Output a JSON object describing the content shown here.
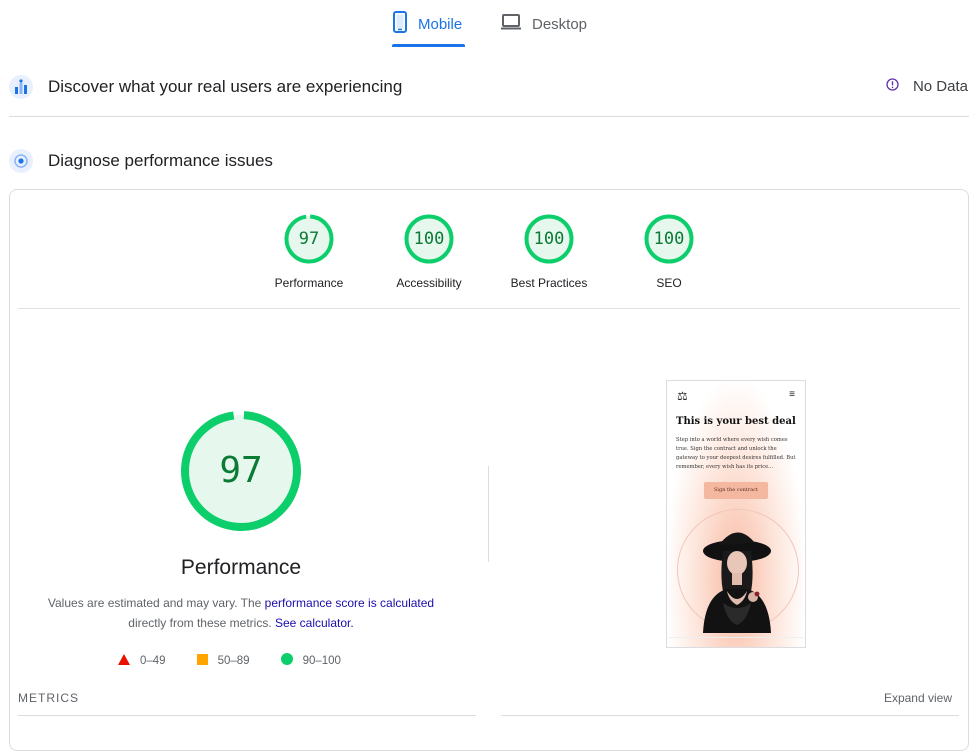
{
  "tabs": [
    {
      "label": "Mobile",
      "icon": "smartphone-icon",
      "active": true
    },
    {
      "label": "Desktop",
      "icon": "laptop-icon",
      "active": false
    }
  ],
  "field_data": {
    "title": "Discover what your real users are experiencing",
    "icon": "field-data-icon",
    "status": "No Data",
    "status_icon": "info-icon"
  },
  "diagnose": {
    "title": "Diagnose performance issues",
    "icon": "lab-data-icon"
  },
  "categories": [
    {
      "label": "Performance",
      "score": "97"
    },
    {
      "label": "Accessibility",
      "score": "100"
    },
    {
      "label": "Best Practices",
      "score": "100"
    },
    {
      "label": "SEO",
      "score": "100"
    }
  ],
  "performance": {
    "score": "97",
    "title": "Performance",
    "desc_prefix": "Values are estimated and may vary. The ",
    "desc_link": "performance score is calculated",
    "desc_mid": "directly from these metrics. ",
    "calc_link": "See calculator."
  },
  "legend": [
    {
      "label": "0–49",
      "shape": "triangle",
      "color": "#eb0f00"
    },
    {
      "label": "50–89",
      "shape": "square",
      "color": "#ffa400"
    },
    {
      "label": "90–100",
      "shape": "circle",
      "color": "#0cce6b"
    }
  ],
  "screenshot": {
    "logo": "⚖",
    "menu": "≡",
    "heading": "This is your best deal",
    "text": "Step into a world where every wish comes true. Sign the contract and unlock the gateway to your deepest desires fulfilled. But remember, every wish has its price...",
    "button": "Sign the contract"
  },
  "metrics": {
    "label": "METRICS",
    "expand": "Expand view"
  },
  "colors": {
    "accent": "#1a73e8",
    "pass": "#0cce6b",
    "pass_text": "#0b7a35",
    "pass_fill": "#e6f8ee"
  }
}
